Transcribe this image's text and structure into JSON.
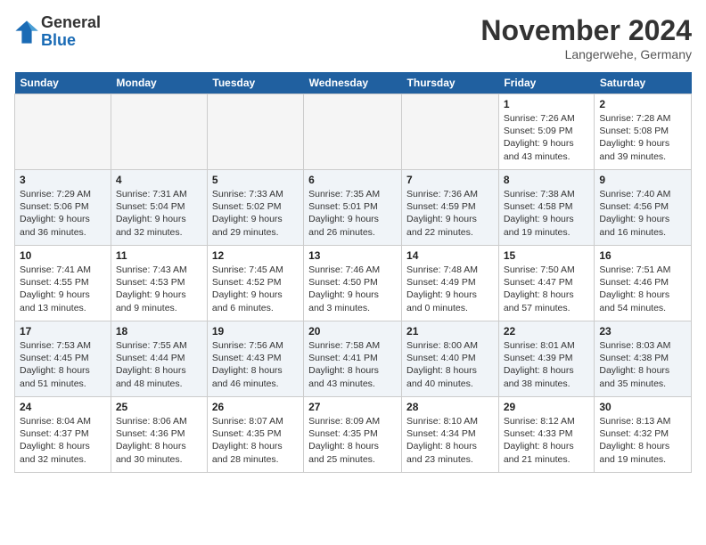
{
  "header": {
    "logo_general": "General",
    "logo_blue": "Blue",
    "month_title": "November 2024",
    "location": "Langerwehe, Germany"
  },
  "days_of_week": [
    "Sunday",
    "Monday",
    "Tuesday",
    "Wednesday",
    "Thursday",
    "Friday",
    "Saturday"
  ],
  "weeks": [
    [
      {
        "day": "",
        "info": ""
      },
      {
        "day": "",
        "info": ""
      },
      {
        "day": "",
        "info": ""
      },
      {
        "day": "",
        "info": ""
      },
      {
        "day": "",
        "info": ""
      },
      {
        "day": "1",
        "info": "Sunrise: 7:26 AM\nSunset: 5:09 PM\nDaylight: 9 hours and 43 minutes."
      },
      {
        "day": "2",
        "info": "Sunrise: 7:28 AM\nSunset: 5:08 PM\nDaylight: 9 hours and 39 minutes."
      }
    ],
    [
      {
        "day": "3",
        "info": "Sunrise: 7:29 AM\nSunset: 5:06 PM\nDaylight: 9 hours and 36 minutes."
      },
      {
        "day": "4",
        "info": "Sunrise: 7:31 AM\nSunset: 5:04 PM\nDaylight: 9 hours and 32 minutes."
      },
      {
        "day": "5",
        "info": "Sunrise: 7:33 AM\nSunset: 5:02 PM\nDaylight: 9 hours and 29 minutes."
      },
      {
        "day": "6",
        "info": "Sunrise: 7:35 AM\nSunset: 5:01 PM\nDaylight: 9 hours and 26 minutes."
      },
      {
        "day": "7",
        "info": "Sunrise: 7:36 AM\nSunset: 4:59 PM\nDaylight: 9 hours and 22 minutes."
      },
      {
        "day": "8",
        "info": "Sunrise: 7:38 AM\nSunset: 4:58 PM\nDaylight: 9 hours and 19 minutes."
      },
      {
        "day": "9",
        "info": "Sunrise: 7:40 AM\nSunset: 4:56 PM\nDaylight: 9 hours and 16 minutes."
      }
    ],
    [
      {
        "day": "10",
        "info": "Sunrise: 7:41 AM\nSunset: 4:55 PM\nDaylight: 9 hours and 13 minutes."
      },
      {
        "day": "11",
        "info": "Sunrise: 7:43 AM\nSunset: 4:53 PM\nDaylight: 9 hours and 9 minutes."
      },
      {
        "day": "12",
        "info": "Sunrise: 7:45 AM\nSunset: 4:52 PM\nDaylight: 9 hours and 6 minutes."
      },
      {
        "day": "13",
        "info": "Sunrise: 7:46 AM\nSunset: 4:50 PM\nDaylight: 9 hours and 3 minutes."
      },
      {
        "day": "14",
        "info": "Sunrise: 7:48 AM\nSunset: 4:49 PM\nDaylight: 9 hours and 0 minutes."
      },
      {
        "day": "15",
        "info": "Sunrise: 7:50 AM\nSunset: 4:47 PM\nDaylight: 8 hours and 57 minutes."
      },
      {
        "day": "16",
        "info": "Sunrise: 7:51 AM\nSunset: 4:46 PM\nDaylight: 8 hours and 54 minutes."
      }
    ],
    [
      {
        "day": "17",
        "info": "Sunrise: 7:53 AM\nSunset: 4:45 PM\nDaylight: 8 hours and 51 minutes."
      },
      {
        "day": "18",
        "info": "Sunrise: 7:55 AM\nSunset: 4:44 PM\nDaylight: 8 hours and 48 minutes."
      },
      {
        "day": "19",
        "info": "Sunrise: 7:56 AM\nSunset: 4:43 PM\nDaylight: 8 hours and 46 minutes."
      },
      {
        "day": "20",
        "info": "Sunrise: 7:58 AM\nSunset: 4:41 PM\nDaylight: 8 hours and 43 minutes."
      },
      {
        "day": "21",
        "info": "Sunrise: 8:00 AM\nSunset: 4:40 PM\nDaylight: 8 hours and 40 minutes."
      },
      {
        "day": "22",
        "info": "Sunrise: 8:01 AM\nSunset: 4:39 PM\nDaylight: 8 hours and 38 minutes."
      },
      {
        "day": "23",
        "info": "Sunrise: 8:03 AM\nSunset: 4:38 PM\nDaylight: 8 hours and 35 minutes."
      }
    ],
    [
      {
        "day": "24",
        "info": "Sunrise: 8:04 AM\nSunset: 4:37 PM\nDaylight: 8 hours and 32 minutes."
      },
      {
        "day": "25",
        "info": "Sunrise: 8:06 AM\nSunset: 4:36 PM\nDaylight: 8 hours and 30 minutes."
      },
      {
        "day": "26",
        "info": "Sunrise: 8:07 AM\nSunset: 4:35 PM\nDaylight: 8 hours and 28 minutes."
      },
      {
        "day": "27",
        "info": "Sunrise: 8:09 AM\nSunset: 4:35 PM\nDaylight: 8 hours and 25 minutes."
      },
      {
        "day": "28",
        "info": "Sunrise: 8:10 AM\nSunset: 4:34 PM\nDaylight: 8 hours and 23 minutes."
      },
      {
        "day": "29",
        "info": "Sunrise: 8:12 AM\nSunset: 4:33 PM\nDaylight: 8 hours and 21 minutes."
      },
      {
        "day": "30",
        "info": "Sunrise: 8:13 AM\nSunset: 4:32 PM\nDaylight: 8 hours and 19 minutes."
      }
    ]
  ]
}
